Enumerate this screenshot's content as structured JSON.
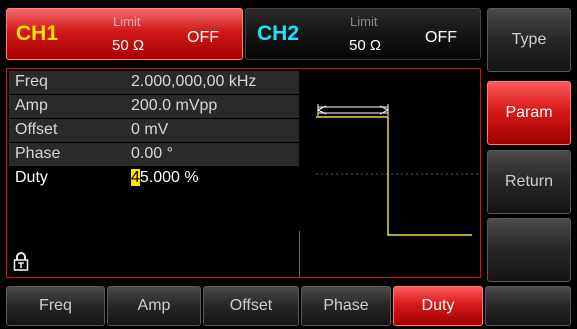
{
  "channels": {
    "ch1": {
      "name": "CH1",
      "limit_label": "Limit",
      "impedance": "50 Ω",
      "state": "OFF",
      "color": "#ffe400"
    },
    "ch2": {
      "name": "CH2",
      "limit_label": "Limit",
      "impedance": "50 Ω",
      "state": "OFF",
      "color": "#22e0ff"
    }
  },
  "params": [
    {
      "name": "Freq",
      "value": "2.000,000,00 kHz"
    },
    {
      "name": "Amp",
      "value": "200.0 mVpp"
    },
    {
      "name": "Offset",
      "value": "0 mV"
    },
    {
      "name": "Phase",
      "value": "0.00 °"
    },
    {
      "name": "Duty",
      "value_cursor": "4",
      "value_rest": "5.000 %",
      "selected": true
    }
  ],
  "softkeys": [
    {
      "label": "Type"
    },
    {
      "label": "Param",
      "active": true
    },
    {
      "label": "Return"
    },
    {
      "label": ""
    }
  ],
  "bottom_menu": [
    {
      "label": "Freq"
    },
    {
      "label": "Amp"
    },
    {
      "label": "Offset"
    },
    {
      "label": "Phase"
    },
    {
      "label": "Duty",
      "active": true
    },
    {
      "label": ""
    }
  ],
  "icons": {
    "lock": "lock-icon"
  },
  "colors": {
    "accent": "#d01818",
    "waveform": "#e8d84a",
    "cursor": "#ffe400"
  }
}
